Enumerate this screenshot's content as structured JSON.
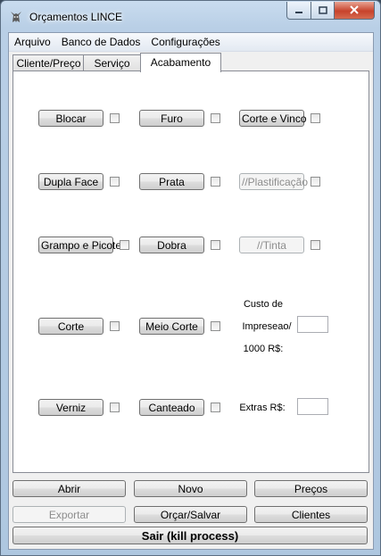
{
  "window": {
    "title": "Orçamentos LINCE",
    "caption_buttons": [
      "minimize-icon",
      "maximize-icon",
      "close-icon"
    ]
  },
  "menu": {
    "items": [
      "Arquivo",
      "Banco de Dados",
      "Configurações"
    ]
  },
  "tabs": [
    {
      "label": "Cliente/Preço",
      "active": false
    },
    {
      "label": "Serviço",
      "active": false
    },
    {
      "label": "Acabamento",
      "active": true
    }
  ],
  "acabamento": {
    "bloquear": {
      "label": "Blocar",
      "checked": false
    },
    "furo": {
      "label": "Furo",
      "checked": false
    },
    "corte_vinco": {
      "label": "Corte e Vinco",
      "checked": false
    },
    "dupla_face": {
      "label": "Dupla Face",
      "checked": false
    },
    "prata": {
      "label": "Prata",
      "checked": false
    },
    "plastificacao": {
      "label": "//Plastificação",
      "checked": false,
      "enabled": false
    },
    "grampo_picote": {
      "label": "Grampo e Picote",
      "checked": false
    },
    "dobra": {
      "label": "Dobra",
      "checked": false
    },
    "tinta": {
      "label": "//Tinta",
      "checked": false,
      "enabled": false
    },
    "corte": {
      "label": "Corte",
      "checked": false
    },
    "meio_corte": {
      "label": "Meio Corte",
      "checked": false
    },
    "verniz": {
      "label": "Verniz",
      "checked": false
    },
    "canteado": {
      "label": "Canteado",
      "checked": false
    },
    "custo_impressao": {
      "label_line1": "Custo de",
      "label_line2": "Impreseao/",
      "label_line3": "1000 R$:",
      "value": ""
    },
    "extras": {
      "label": "Extras R$:",
      "value": ""
    }
  },
  "bottom_buttons": {
    "abrir": "Abrir",
    "novo": "Novo",
    "precos": "Preços",
    "exportar": "Exportar",
    "orcar_salvar": "Orçar/Salvar",
    "clientes": "Clientes",
    "sair": "Sair (kill process)"
  }
}
